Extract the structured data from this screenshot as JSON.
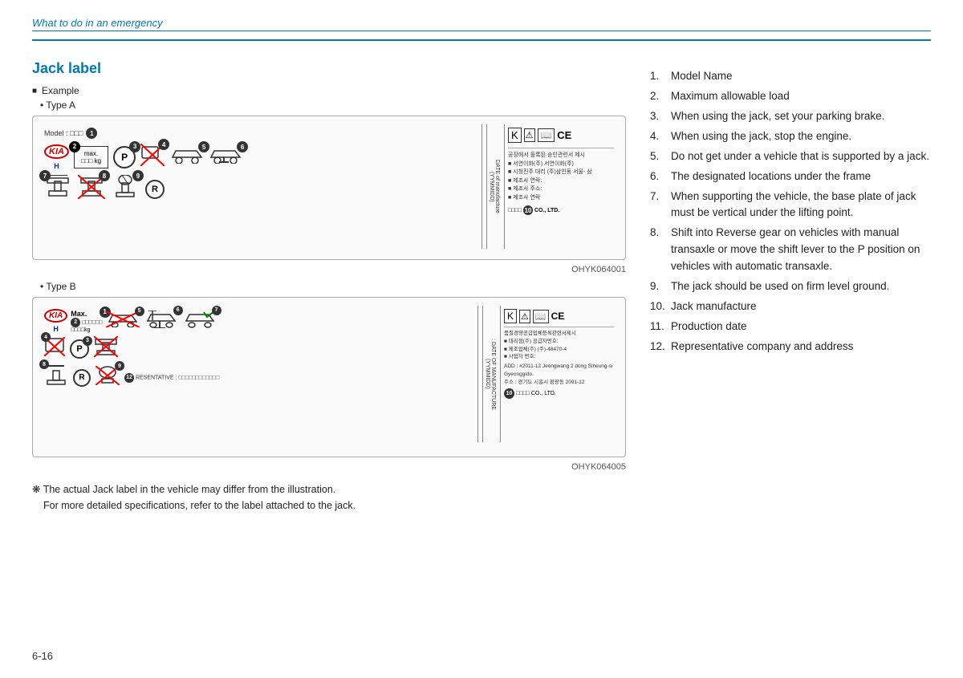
{
  "header": {
    "title": "What to do in an emergency"
  },
  "section": {
    "title": "Jack label"
  },
  "examples": {
    "label": "Example",
    "typeA": "Type A",
    "typeB": "Type B",
    "ohykA": "OHYK064001",
    "ohykB": "OHYK064005"
  },
  "numbered_list": [
    {
      "num": "1.",
      "text": "Model Name"
    },
    {
      "num": "2.",
      "text": "Maximum allowable load"
    },
    {
      "num": "3.",
      "text": "When  using  the  jack,  set  your parking brake."
    },
    {
      "num": "4.",
      "text": "When  using  the  jack,  stop  the engine."
    },
    {
      "num": "5.",
      "text": "Do  not  get  under  a  vehicle  that  is supported by a jack."
    },
    {
      "num": "6.",
      "text": "The  designated  locations  under the frame"
    },
    {
      "num": "7.",
      "text": "When  supporting  the  vehicle,  the base plate of jack must be vertical under the lifting point."
    },
    {
      "num": "8.",
      "text": "Shift into Reverse gear on vehicles with manual transaxle or move the shift  lever  to  the  P  position  on vehicles with automatic transaxle."
    },
    {
      "num": "9.",
      "text": "The  jack  should  be  used  on  firm level ground."
    },
    {
      "num": "10.",
      "text": "Jack manufacture"
    },
    {
      "num": "11.",
      "text": "Production date"
    },
    {
      "num": "12.",
      "text": "Representative   company   and address"
    }
  ],
  "footer": {
    "note_line1": "❋ The actual Jack label in the vehicle may differ from the illustration.",
    "note_line2": "For more detailed specifications, refer to the label attached to the jack."
  },
  "page_number": "6-16"
}
